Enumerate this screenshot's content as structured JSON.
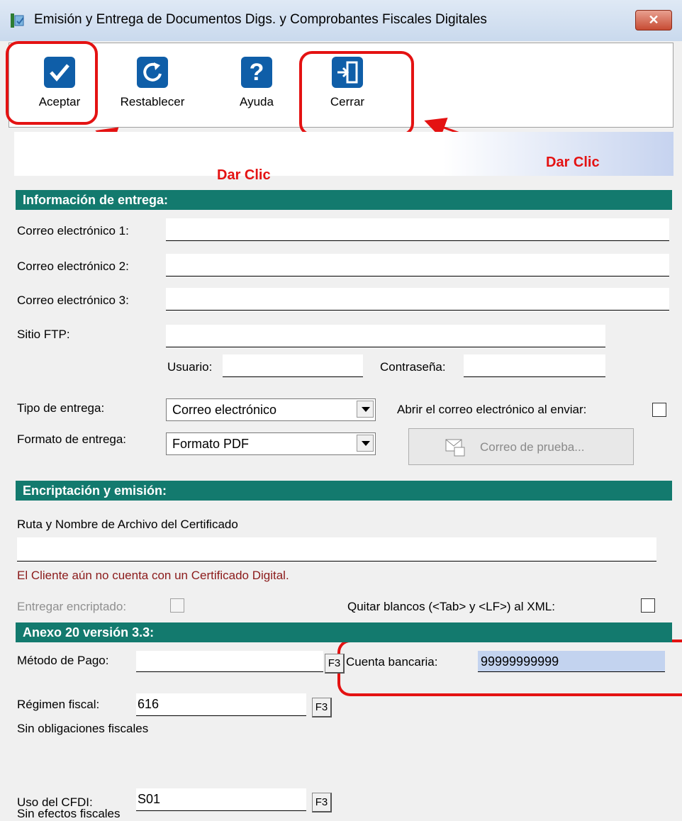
{
  "window": {
    "title": "Emisión y Entrega de Documentos Digs. y Comprobantes Fiscales Digitales",
    "close_label": "✕"
  },
  "toolbar": {
    "accept_label": "Aceptar",
    "reset_label": "Restablecer",
    "help_label": "Ayuda",
    "close_label": "Cerrar"
  },
  "annotations": {
    "left": "Dar Clic",
    "right": "Dar Clic"
  },
  "delivery": {
    "section_title": "Información de entrega:",
    "email1_label": "Correo electrónico 1:",
    "email1_value": "",
    "email2_label": "Correo electrónico 2:",
    "email2_value": "",
    "email3_label": "Correo electrónico 3:",
    "email3_value": "",
    "ftp_label": "Sitio FTP:",
    "ftp_value": "",
    "user_label": "Usuario:",
    "user_value": "",
    "password_label": "Contraseña:",
    "password_value": "",
    "delivery_type_label": "Tipo de entrega:",
    "delivery_type_value": "Correo electrónico",
    "open_email_label": "Abrir el correo electrónico al enviar:",
    "delivery_format_label": "Formato de entrega:",
    "delivery_format_value": "Formato PDF",
    "test_email_label": "Correo de prueba..."
  },
  "encryption": {
    "section_title": "Encriptación y emisión:",
    "cert_path_label": "Ruta y Nombre de Archivo del Certificado",
    "cert_path_value": "",
    "warning": "El Cliente aún no cuenta con un Certificado Digital.",
    "encrypt_label": "Entregar encriptado:",
    "strip_label": "Quitar blancos (<Tab> y <LF>) al  XML:"
  },
  "annex": {
    "section_title": "Anexo 20 versión 3.3:",
    "payment_method_label": "Método de Pago:",
    "payment_method_value": "",
    "bank_account_label": "Cuenta bancaria:",
    "bank_account_value": "99999999999",
    "tax_regime_label": "Régimen fiscal:",
    "tax_regime_value": "616",
    "tax_regime_desc": "Sin obligaciones fiscales",
    "cfdi_use_label": "Uso del CFDI:",
    "cfdi_use_value": "S01",
    "cfdi_use_desc": "Sin efectos fiscales",
    "f3_label": "F3"
  }
}
